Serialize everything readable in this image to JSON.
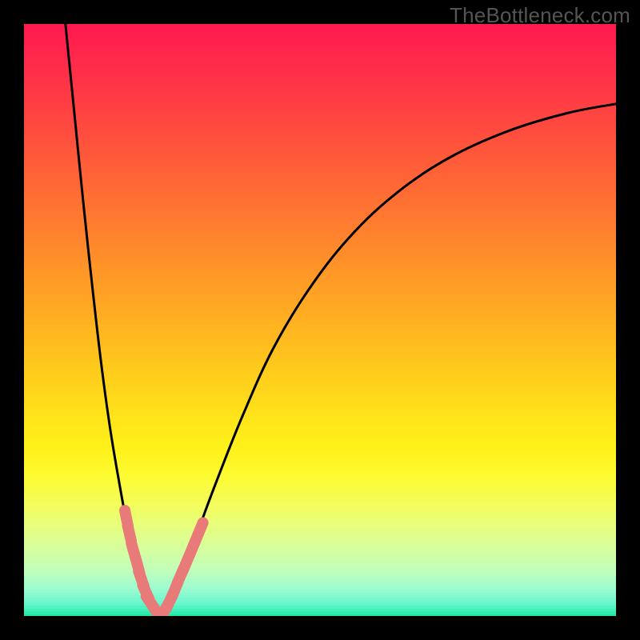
{
  "watermark": "TheBottleneck.com",
  "chart_data": {
    "type": "line",
    "title": "",
    "xlabel": "",
    "ylabel": "",
    "xlim": [
      0,
      100
    ],
    "ylim": [
      0,
      100
    ],
    "background_gradient": {
      "description": "Vertical rainbow gradient indicating bottleneck severity (green=good at bottom to red=bad at top)",
      "stops": [
        {
          "pos": 0.0,
          "color": "#ff1a4f"
        },
        {
          "pos": 0.06,
          "color": "#ff2a4a"
        },
        {
          "pos": 0.12,
          "color": "#ff3b44"
        },
        {
          "pos": 0.18,
          "color": "#ff4d3e"
        },
        {
          "pos": 0.24,
          "color": "#ff5f38"
        },
        {
          "pos": 0.3,
          "color": "#ff7232"
        },
        {
          "pos": 0.36,
          "color": "#ff852d"
        },
        {
          "pos": 0.42,
          "color": "#ff9827"
        },
        {
          "pos": 0.48,
          "color": "#ffab22"
        },
        {
          "pos": 0.54,
          "color": "#ffbe1e"
        },
        {
          "pos": 0.6,
          "color": "#ffd11b"
        },
        {
          "pos": 0.66,
          "color": "#ffe41a"
        },
        {
          "pos": 0.72,
          "color": "#fff31c"
        },
        {
          "pos": 0.76,
          "color": "#fdfb32"
        },
        {
          "pos": 0.8,
          "color": "#f5fd55"
        },
        {
          "pos": 0.84,
          "color": "#e9fe7a"
        },
        {
          "pos": 0.88,
          "color": "#d8fe9c"
        },
        {
          "pos": 0.92,
          "color": "#c0febb"
        },
        {
          "pos": 0.95,
          "color": "#9cfccf"
        },
        {
          "pos": 0.975,
          "color": "#6bf7ce"
        },
        {
          "pos": 0.99,
          "color": "#35eeb3"
        },
        {
          "pos": 1.0,
          "color": "#0be18f"
        }
      ]
    },
    "series": [
      {
        "name": "left-curve",
        "stroke": "#000000",
        "x": [
          7.0,
          8.5,
          10.0,
          11.5,
          13.0,
          14.5,
          16.0,
          17.5,
          19.0,
          20.0,
          21.0,
          22.0,
          23.0
        ],
        "y": [
          100,
          85,
          70,
          56,
          43,
          32,
          23,
          15,
          9,
          5,
          2.5,
          1.0,
          0.0
        ]
      },
      {
        "name": "right-curve",
        "stroke": "#000000",
        "x": [
          23.0,
          24.5,
          26.0,
          28.0,
          30.0,
          33.0,
          37.0,
          42.0,
          48.0,
          55.0,
          63.0,
          72.0,
          82.0,
          92.0,
          100.0
        ],
        "y": [
          0.0,
          2.0,
          5.0,
          10.0,
          16.0,
          24.0,
          34.0,
          45.0,
          55.0,
          64.0,
          71.5,
          77.5,
          82.0,
          85.0,
          86.5
        ]
      },
      {
        "name": "left-dots",
        "stroke": "#e97a7a",
        "marker": "circle",
        "x": [
          17.3,
          17.8,
          18.5,
          19.2,
          19.8,
          20.6,
          21.4,
          22.2
        ],
        "y": [
          16.5,
          14.0,
          11.0,
          8.5,
          6.3,
          4.0,
          2.2,
          1.0
        ]
      },
      {
        "name": "right-dots",
        "stroke": "#e97a7a",
        "marker": "circle",
        "x": [
          23.8,
          24.6,
          25.5,
          26.4,
          27.4,
          28.5,
          29.7
        ],
        "y": [
          1.0,
          2.5,
          4.5,
          6.7,
          9.0,
          11.6,
          14.5
        ]
      }
    ],
    "optimum_x": 23
  }
}
